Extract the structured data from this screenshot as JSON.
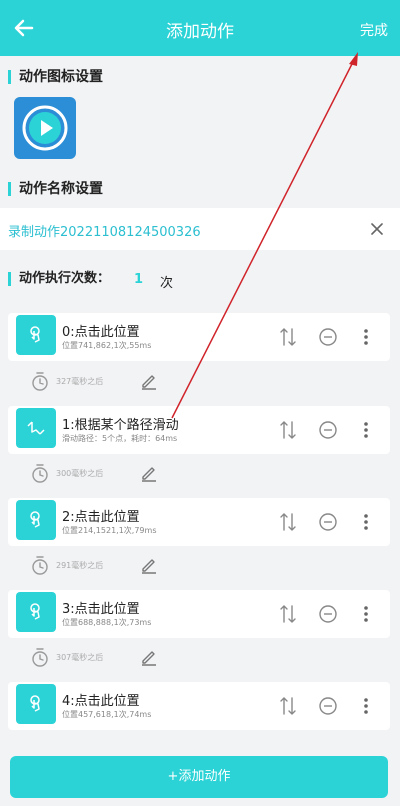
{
  "header": {
    "title": "添加动作",
    "done_label": "完成"
  },
  "icon_section": {
    "title": "动作图标设置"
  },
  "name_section": {
    "title": "动作名称设置",
    "value": "录制动作20221108124500326"
  },
  "exec_count": {
    "label": "动作执行次数：",
    "value": "1",
    "unit": "次"
  },
  "actions": [
    {
      "title": "0:点击此位置",
      "detail": "位置741,862,1次,55ms",
      "delay": "327毫秒之后",
      "icon": "tap-icon"
    },
    {
      "title": "1:根据某个路径滑动",
      "detail": "滑动路径：5个点，耗时：64ms",
      "delay": "300毫秒之后",
      "icon": "swipe-path-icon"
    },
    {
      "title": "2:点击此位置",
      "detail": "位置214,1521,1次,79ms",
      "delay": "291毫秒之后",
      "icon": "tap-icon"
    },
    {
      "title": "3:点击此位置",
      "detail": "位置688,888,1次,73ms",
      "delay": "307毫秒之后",
      "icon": "tap-icon"
    },
    {
      "title": "4:点击此位置",
      "detail": "位置457,618,1次,74ms",
      "delay": "",
      "icon": "tap-icon"
    }
  ],
  "add_button_label": "+添加动作",
  "colors": {
    "accent": "#2bd3d6",
    "app_icon_bg": "#2c8ed6",
    "annotation_arrow": "#d0242b"
  }
}
